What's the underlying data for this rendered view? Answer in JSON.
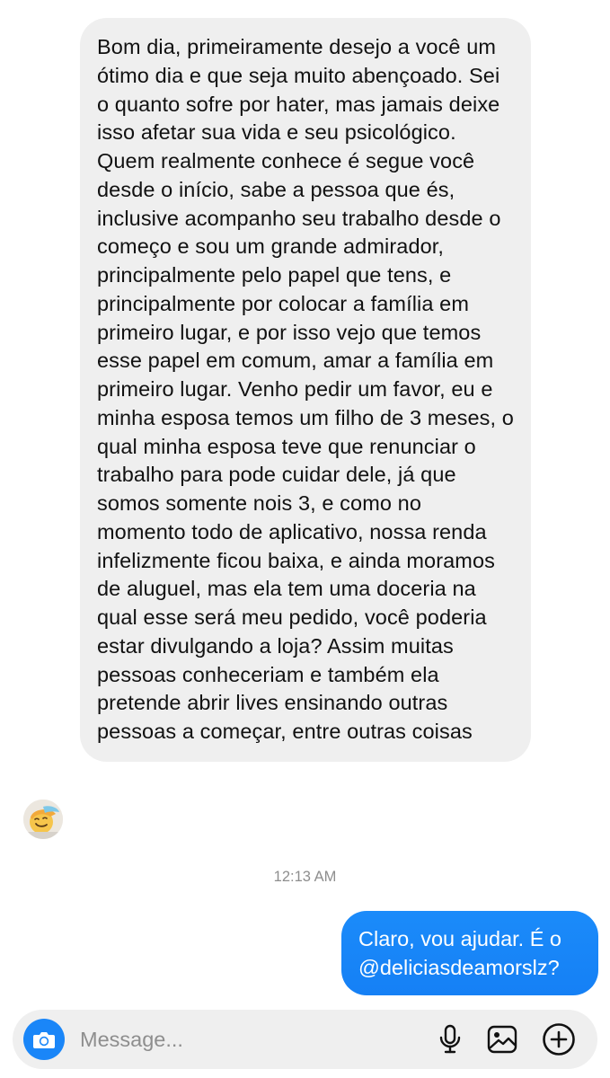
{
  "thread": {
    "incoming": {
      "text": "Bom dia, primeiramente desejo a você um ótimo dia e que seja muito abençoado. Sei o quanto sofre por hater, mas jamais deixe isso afetar sua vida e seu psicológico. Quem realmente conhece é segue você desde o início, sabe a pessoa que és, inclusive acompanho seu trabalho desde o começo e sou um grande admirador, principalmente pelo papel que tens, e principalmente por colocar a família em primeiro lugar, e por isso vejo que temos esse papel em comum, amar a família em primeiro lugar. Venho pedir um favor, eu e minha esposa temos um filho de 3 meses, o qual minha esposa teve que renunciar o trabalho para pode cuidar dele, já que somos somente nois 3, e como no momento todo de aplicativo, nossa renda infelizmente ficou baixa, e ainda moramos de aluguel, mas ela tem uma doceria na qual esse será meu pedido, você poderia estar divulgando a loja? Assim muitas pessoas conheceriam e também ela pretende abrir lives ensinando outras pessoas a começar, entre outras coisas"
    },
    "timestamp": "12:13 AM",
    "outgoing": {
      "text": "Claro, vou ajudar. É o @deliciasdeamorslz?"
    }
  },
  "composer": {
    "placeholder": "Message...",
    "value": "",
    "icons": {
      "camera": "camera-icon",
      "mic": "microphone-icon",
      "gallery": "image-icon",
      "add": "plus-circle-icon"
    }
  },
  "colors": {
    "incoming_bubble": "#efefef",
    "outgoing_bubble": "#1a86f8",
    "accent": "#1a86f8",
    "timestamp": "#8e8e8e"
  }
}
